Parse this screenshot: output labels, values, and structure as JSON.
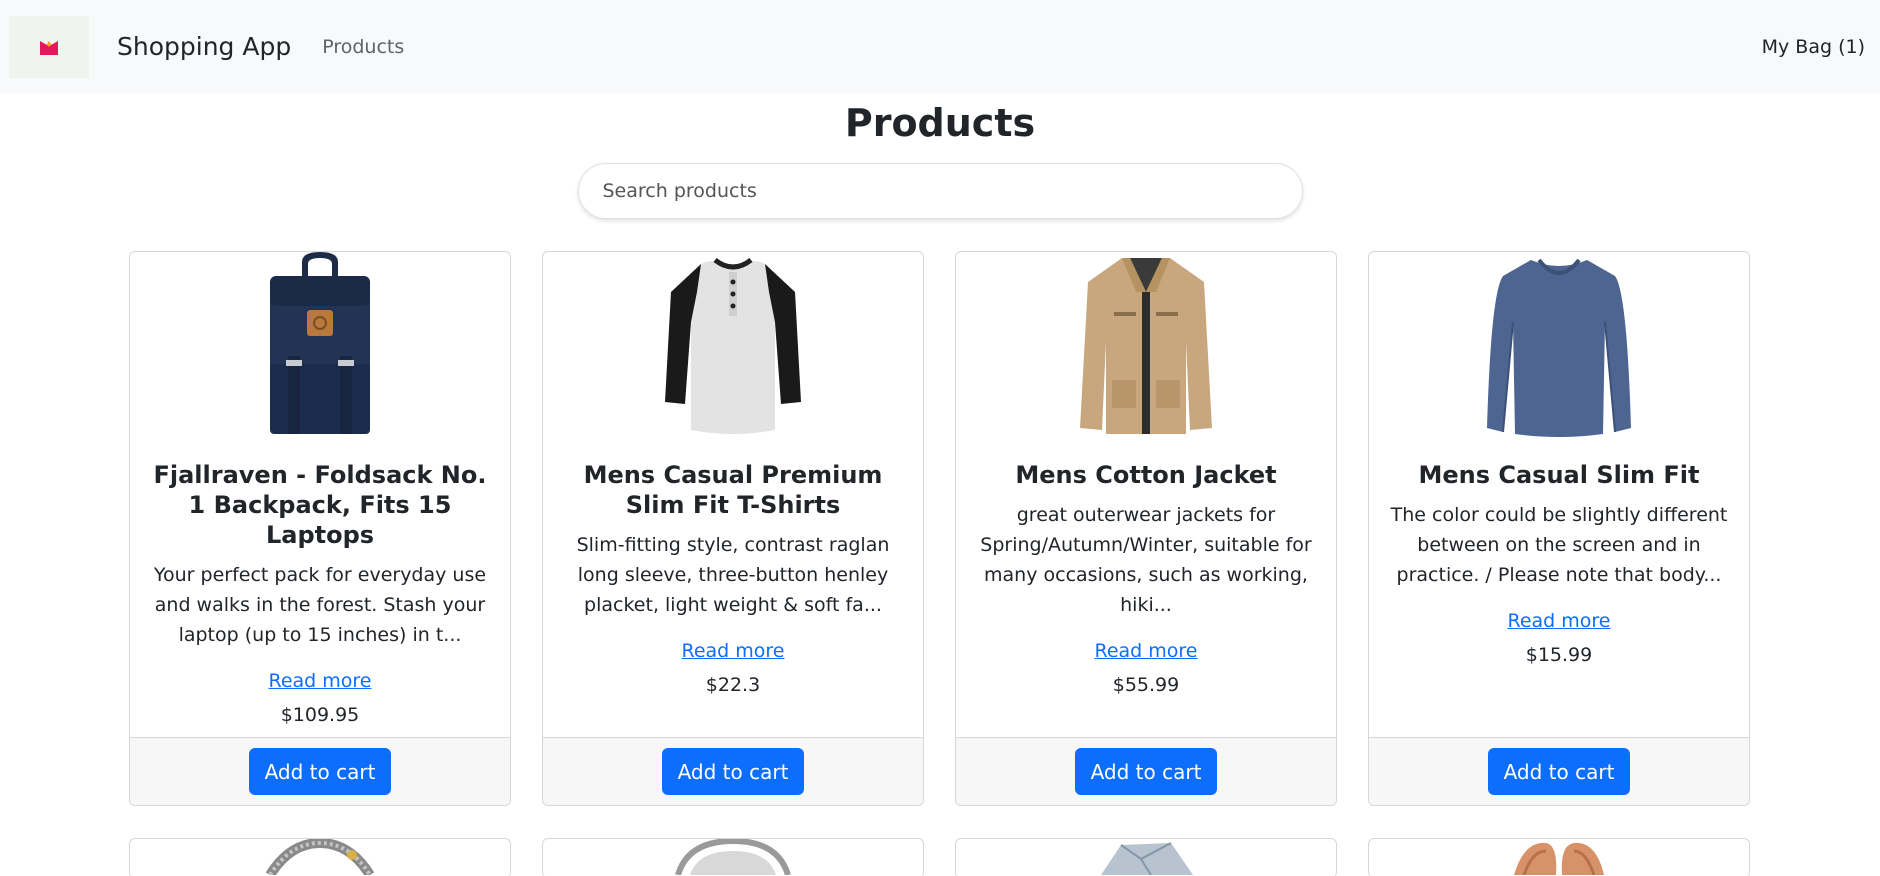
{
  "navbar": {
    "brand": "Shopping App",
    "products_link": "Products",
    "bag_label": "My Bag (1)"
  },
  "page": {
    "title": "Products"
  },
  "search": {
    "placeholder": "Search products"
  },
  "colors": {
    "accent": "#0d6efd",
    "logo_pink": "#e8175d",
    "logo_orange": "#f7a21b"
  },
  "products": [
    {
      "title": "Fjallraven - Foldsack No. 1 Backpack, Fits 15 Laptops",
      "description": "Your perfect pack for everyday use and walks in the forest. Stash your laptop (up to 15 inches) in t...",
      "read_more": "Read more",
      "price": "$109.95",
      "button": "Add to cart",
      "image_icon": "backpack-image"
    },
    {
      "title": "Mens Casual Premium Slim Fit T-Shirts",
      "description": "Slim-fitting style, contrast raglan long sleeve, three-button henley placket, light weight & soft fa...",
      "read_more": "Read more",
      "price": "$22.3",
      "button": "Add to cart",
      "image_icon": "tshirt-image"
    },
    {
      "title": "Mens Cotton Jacket",
      "description": "great outerwear jackets for Spring/Autumn/Winter, suitable for many occasions, such as working, hiki...",
      "read_more": "Read more",
      "price": "$55.99",
      "button": "Add to cart",
      "image_icon": "jacket-image"
    },
    {
      "title": "Mens Casual Slim Fit",
      "description": "The color could be slightly different between on the screen and in practice. / Please note that body...",
      "read_more": "Read more",
      "price": "$15.99",
      "button": "Add to cart",
      "image_icon": "longsleeve-image"
    }
  ],
  "partial_row": [
    {
      "image_icon": "bracelet-image"
    },
    {
      "image_icon": "ring-image"
    },
    {
      "image_icon": "gem-ring-image"
    },
    {
      "image_icon": "gold-ring-image"
    }
  ]
}
